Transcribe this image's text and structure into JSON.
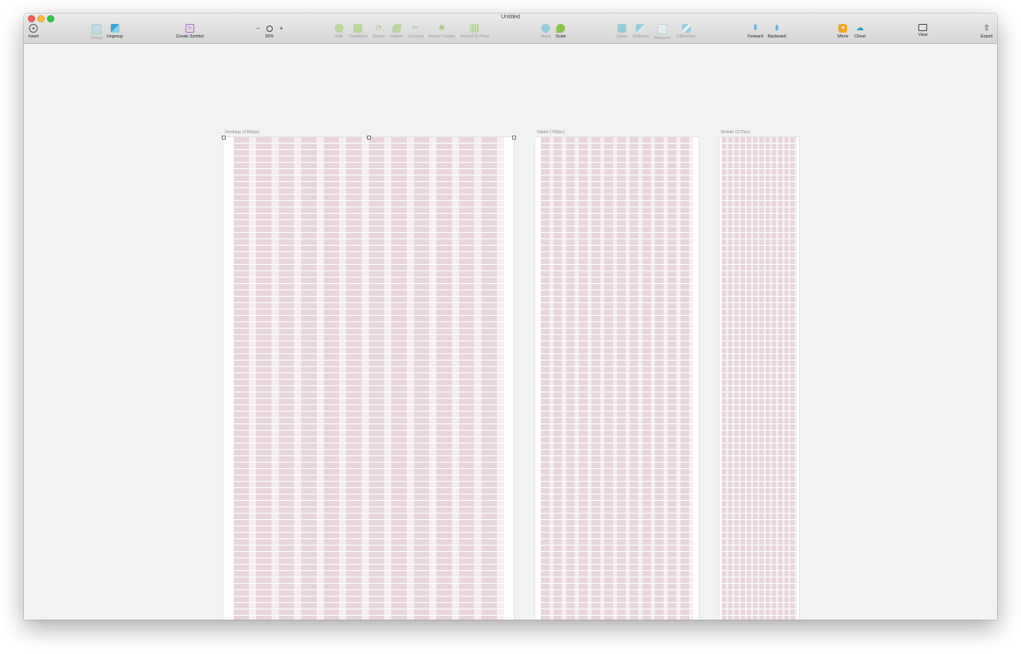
{
  "window": {
    "title": "Untitled"
  },
  "toolbar": {
    "insert": {
      "label": "Insert",
      "icon": "plus-icon"
    },
    "group": {
      "label": "Group",
      "icon": "group-icon"
    },
    "ungroup": {
      "label": "Ungroup",
      "icon": "ungroup-icon"
    },
    "create_symbol": {
      "label": "Create Symbol",
      "icon": "symbol-icon"
    },
    "zoom": {
      "label": "50%",
      "minus": "−",
      "plus": "+",
      "icon": "magnifier-icon"
    },
    "edit": {
      "label": "Edit",
      "icon": "edit-icon"
    },
    "transform": {
      "label": "Transform",
      "icon": "transform-icon"
    },
    "rotate": {
      "label": "Rotate",
      "icon": "rotate-icon"
    },
    "flatten": {
      "label": "Flatten",
      "icon": "flatten-icon"
    },
    "scissors": {
      "label": "Scissors",
      "icon": "scissors-icon"
    },
    "rotate_copies": {
      "label": "Rotate Copies",
      "icon": "rotate-copies-icon"
    },
    "round_to_pixel": {
      "label": "Round To Pixel",
      "icon": "round-to-pixel-icon"
    },
    "mask": {
      "label": "Mask",
      "icon": "mask-icon"
    },
    "scale": {
      "label": "Scale",
      "icon": "scale-icon"
    },
    "union": {
      "label": "Union",
      "icon": "union-icon"
    },
    "subtract": {
      "label": "Subtract",
      "icon": "subtract-icon"
    },
    "intersect": {
      "label": "Intersect",
      "icon": "intersect-icon"
    },
    "difference": {
      "label": "Difference",
      "icon": "difference-icon"
    },
    "forward": {
      "label": "Forward",
      "icon": "forward-icon"
    },
    "backward": {
      "label": "Backward",
      "icon": "backward-icon"
    },
    "mirror": {
      "label": "Mirror",
      "icon": "mirror-icon"
    },
    "cloud": {
      "label": "Cloud",
      "icon": "cloud-icon"
    },
    "view": {
      "label": "View",
      "icon": "view-icon"
    },
    "export": {
      "label": "Export",
      "icon": "export-icon"
    }
  },
  "artboards": [
    {
      "label": "Desktop (1366px)",
      "columns": 12,
      "selected": true
    },
    {
      "label": "Tablet (768px)",
      "columns": 12,
      "selected": false
    },
    {
      "label": "Mobile (375px)",
      "columns": 12,
      "selected": false
    }
  ],
  "colors": {
    "grid_column": "#e8d5dc",
    "grid_gutter": "#f6eef1",
    "grid_row_line": "#ffffff",
    "canvas": "#f2f2f2",
    "accent_teal": "#5bbdd4",
    "accent_green": "#8bc34a"
  }
}
